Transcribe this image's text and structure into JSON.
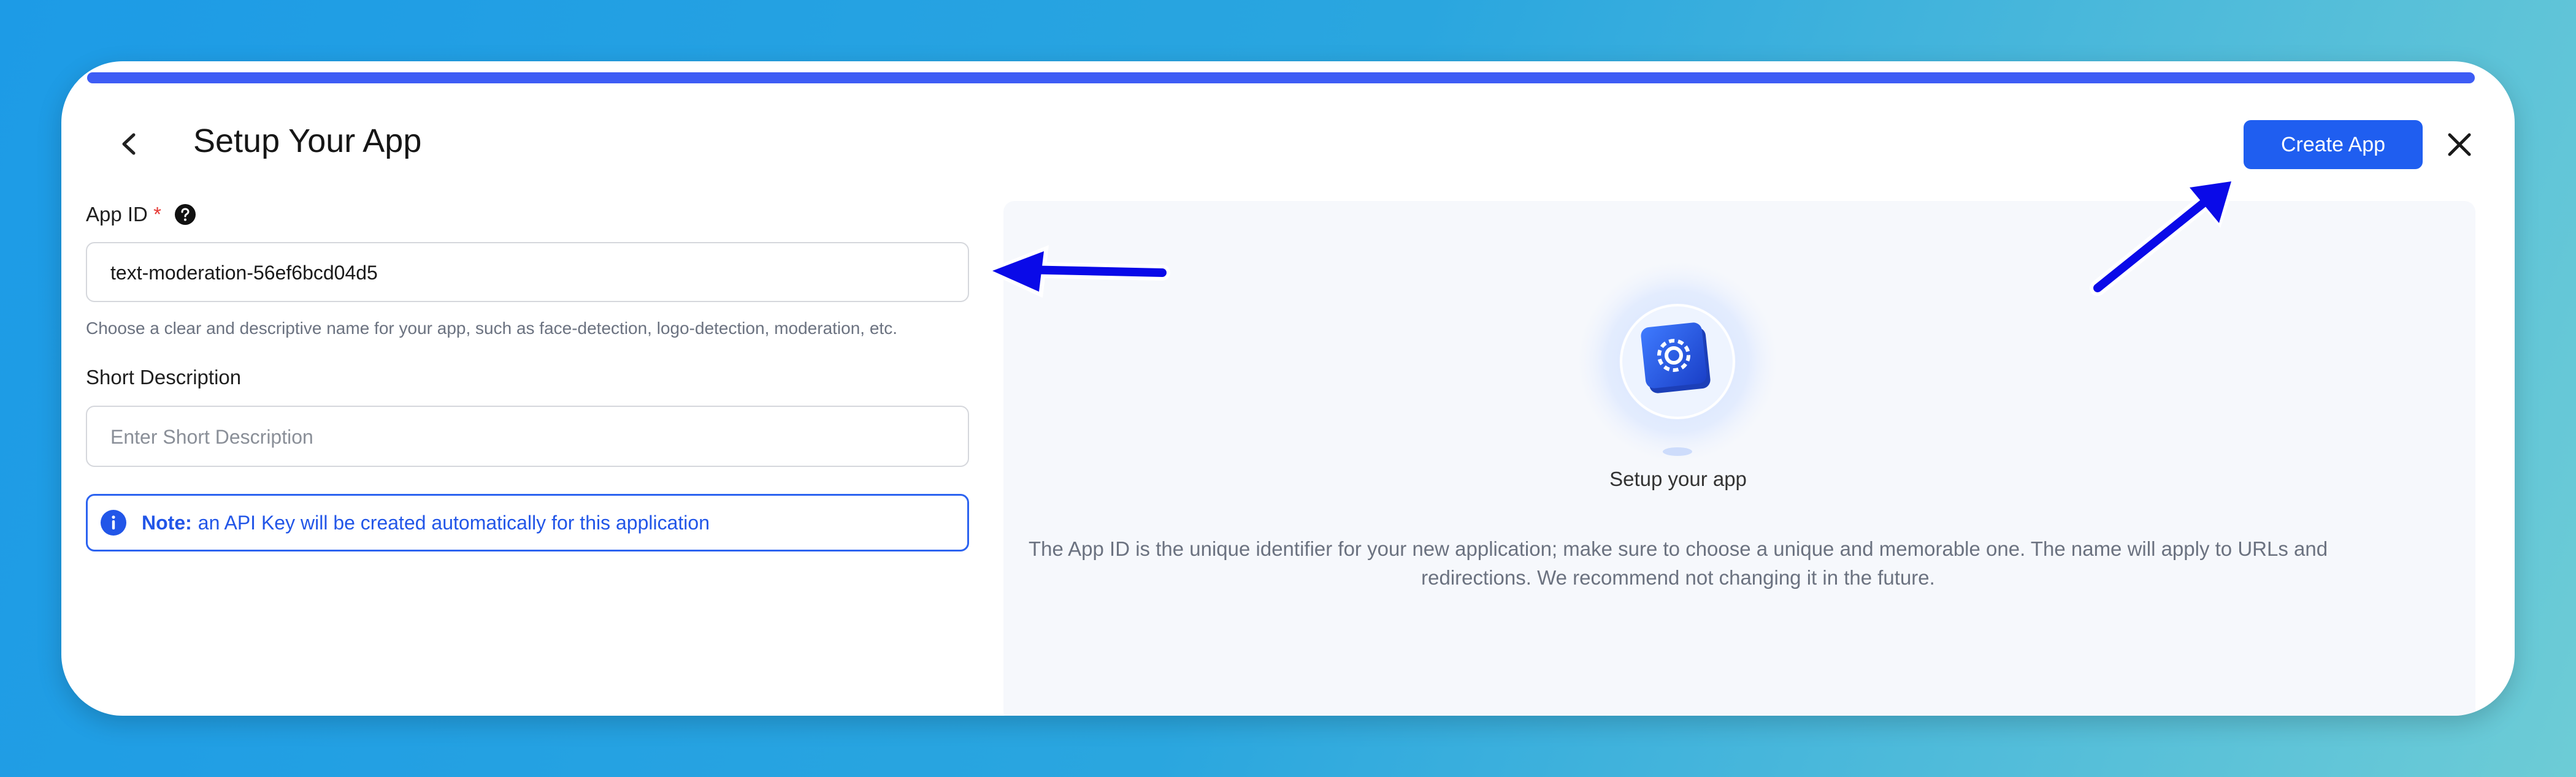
{
  "header": {
    "title": "Setup Your App",
    "create_button_label": "Create App"
  },
  "form": {
    "app_id": {
      "label": "App ID",
      "required_mark": "*",
      "value": "text-moderation-56ef6bcd04d5",
      "hint": "Choose a clear and descriptive name for your app, such as face-detection, logo-detection, moderation, etc."
    },
    "short_description": {
      "label": "Short Description",
      "placeholder": "Enter Short Description",
      "value": ""
    },
    "note": {
      "prefix": "Note:",
      "text": "an API Key will be created automatically for this application"
    }
  },
  "panel": {
    "heading": "Setup your app",
    "body": "The App ID is the unique identifier for your new application; make sure to choose a unique and memorable one. The name will apply to URLs and redirections. We recommend not changing it in the future."
  },
  "icons": {
    "back": "chevron-left-icon",
    "close": "close-icon",
    "help": "question-circle-icon",
    "info": "info-circle-icon",
    "illustration": "gear-cube-icon"
  },
  "colors": {
    "accent": "#1f5ef0",
    "progress": "#3d5cf5",
    "note": "#2256e8",
    "required": "#e53935",
    "annotation_arrow": "#0a0ae8"
  },
  "progress": 1.0
}
